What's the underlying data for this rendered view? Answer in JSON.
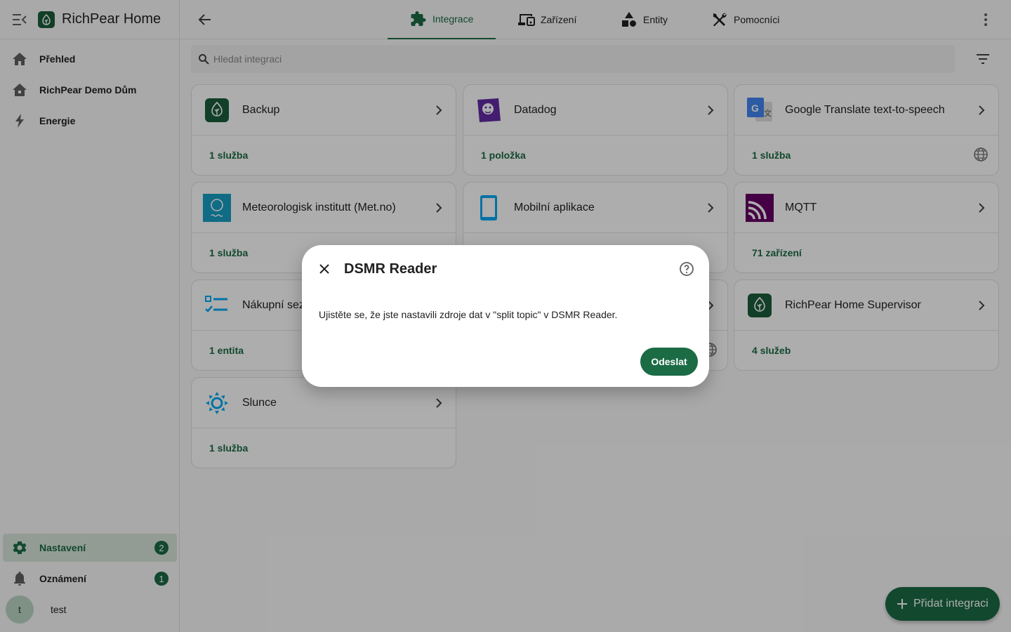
{
  "app": {
    "title": "RichPear Home"
  },
  "sidebar": {
    "items": [
      {
        "label": "Přehled",
        "icon": "home-icon"
      },
      {
        "label": "RichPear Demo Dům",
        "icon": "house-icon"
      },
      {
        "label": "Energie",
        "icon": "lightning-icon"
      }
    ],
    "bottom": [
      {
        "label": "Nastavení",
        "icon": "gear-icon",
        "badge": "2"
      },
      {
        "label": "Oznámení",
        "icon": "bell-icon",
        "badge": "1"
      }
    ],
    "user": {
      "initial": "t",
      "name": "test"
    }
  },
  "tabs": [
    {
      "label": "Integrace",
      "icon": "puzzle-icon"
    },
    {
      "label": "Zařízení",
      "icon": "devices-icon"
    },
    {
      "label": "Entity",
      "icon": "shapes-icon"
    },
    {
      "label": "Pomocníci",
      "icon": "tools-icon"
    }
  ],
  "search": {
    "placeholder": "Hledat integraci"
  },
  "cards": [
    {
      "name": "Backup",
      "link": "1 služba"
    },
    {
      "name": "Datadog",
      "link": "1 položka"
    },
    {
      "name": "Google Translate text-to-speech",
      "link": "1 služba"
    },
    {
      "name": "Meteorologisk institutt (Met.no)",
      "link": "1 služba"
    },
    {
      "name": "Mobilní aplikace",
      "link": ""
    },
    {
      "name": "MQTT",
      "link": "71 zařízení"
    },
    {
      "name": "Nákupní sez",
      "link": "1 entita"
    },
    {
      "name": "",
      "link": ""
    },
    {
      "name": "RichPear Home Supervisor",
      "link": "4 služeb"
    },
    {
      "name": "Slunce",
      "link": "1 služba"
    }
  ],
  "fab": {
    "label": "Přidat integraci"
  },
  "dialog": {
    "title": "DSMR Reader",
    "body": "Ujistěte se, že jste nastavili zdroje dat v \"split topic\" v DSMR Reader.",
    "submit": "Odeslat"
  },
  "colors": {
    "primary": "#1b6b45",
    "scrim": "rgba(0,0,0,0.32)"
  }
}
